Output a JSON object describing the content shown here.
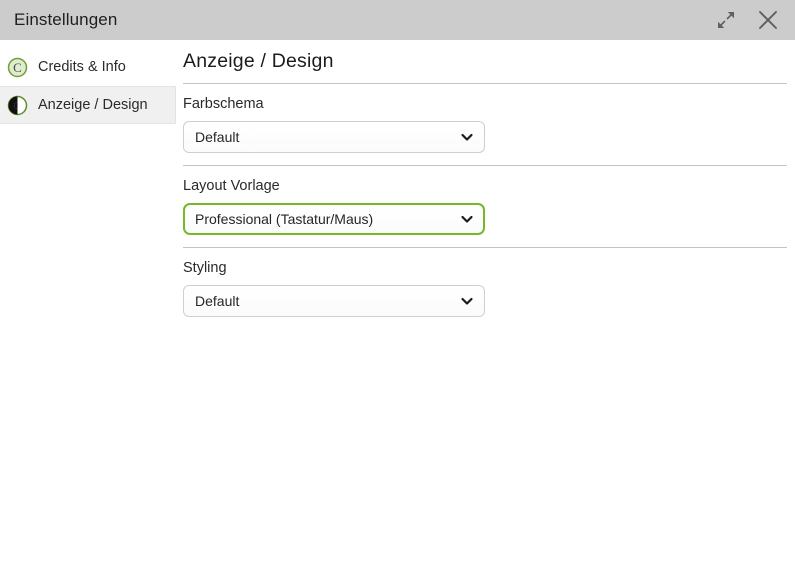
{
  "titlebar": {
    "title": "Einstellungen",
    "expand_icon": "expand-arrows-icon",
    "close_icon": "close-icon"
  },
  "sidebar": {
    "items": [
      {
        "label": "Credits & Info",
        "icon": "copyright-circle-icon",
        "selected": false
      },
      {
        "label": "Anzeige / Design",
        "icon": "contrast-circle-icon",
        "selected": true
      }
    ]
  },
  "main": {
    "heading": "Anzeige / Design",
    "groups": [
      {
        "label": "Farbschema",
        "value": "Default",
        "focused": false,
        "options": [
          "Default"
        ]
      },
      {
        "label": "Layout Vorlage",
        "value": "Professional (Tastatur/Maus)",
        "focused": true,
        "options": [
          "Professional (Tastatur/Maus)"
        ]
      },
      {
        "label": "Styling",
        "value": "Default",
        "focused": false,
        "options": [
          "Default"
        ]
      }
    ]
  },
  "colors": {
    "titlebar_bg": "#cccccc",
    "accent_green": "#76b82a",
    "selected_row_bg": "#f0f0f0",
    "rule": "#c4c4c4"
  }
}
